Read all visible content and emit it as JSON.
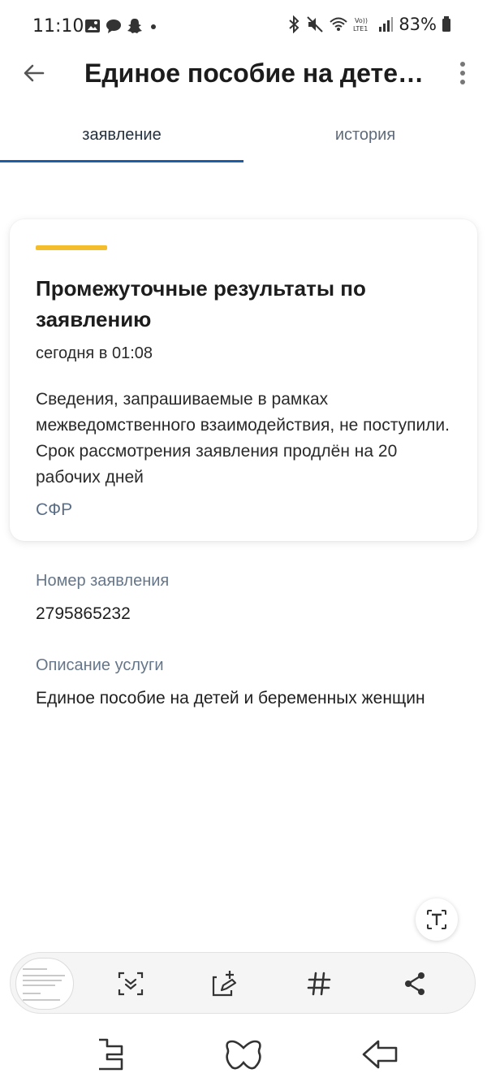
{
  "status_bar": {
    "time": "11:10",
    "battery": "83%",
    "left_icons": [
      "image-icon",
      "chat-icon",
      "snapchat-icon",
      "dot-icon"
    ],
    "right_icons": [
      "bluetooth-icon",
      "mute-icon",
      "wifi-icon",
      "volte-icon",
      "signal-icon",
      "battery-icon"
    ]
  },
  "app_bar": {
    "title": "Единое пособие на детей...",
    "back_icon": "back-arrow-icon",
    "menu_icon": "more-vert-icon"
  },
  "tabs": [
    {
      "label": "заявление",
      "active": true
    },
    {
      "label": "история",
      "active": false
    }
  ],
  "card": {
    "title": "Промежуточные результаты по заявлению",
    "time": "сегодня в 01:08",
    "body": "Сведения, запрашиваемые в рамках межведомственного взаимодействия, не поступили. Срок рассмотрения заявления продлён на 20 рабочих дней",
    "source": "СФР",
    "accent_color": "#f3bd2c"
  },
  "fields": {
    "application_number_label": "Номер заявления",
    "application_number": "2795865232",
    "service_description_label": "Описание услуги",
    "service_description": "Единое пособие на детей и беременных женщин"
  },
  "screenshot_toolbar": {
    "tools": [
      "scroll-capture-icon",
      "edit-icon",
      "tag-icon",
      "share-icon"
    ]
  },
  "nav_bar": {
    "buttons": [
      "recent-apps-icon",
      "home-icon",
      "back-icon"
    ]
  },
  "colors": {
    "tab_indicator": "#1d5da8",
    "muted_label": "#66768a"
  }
}
